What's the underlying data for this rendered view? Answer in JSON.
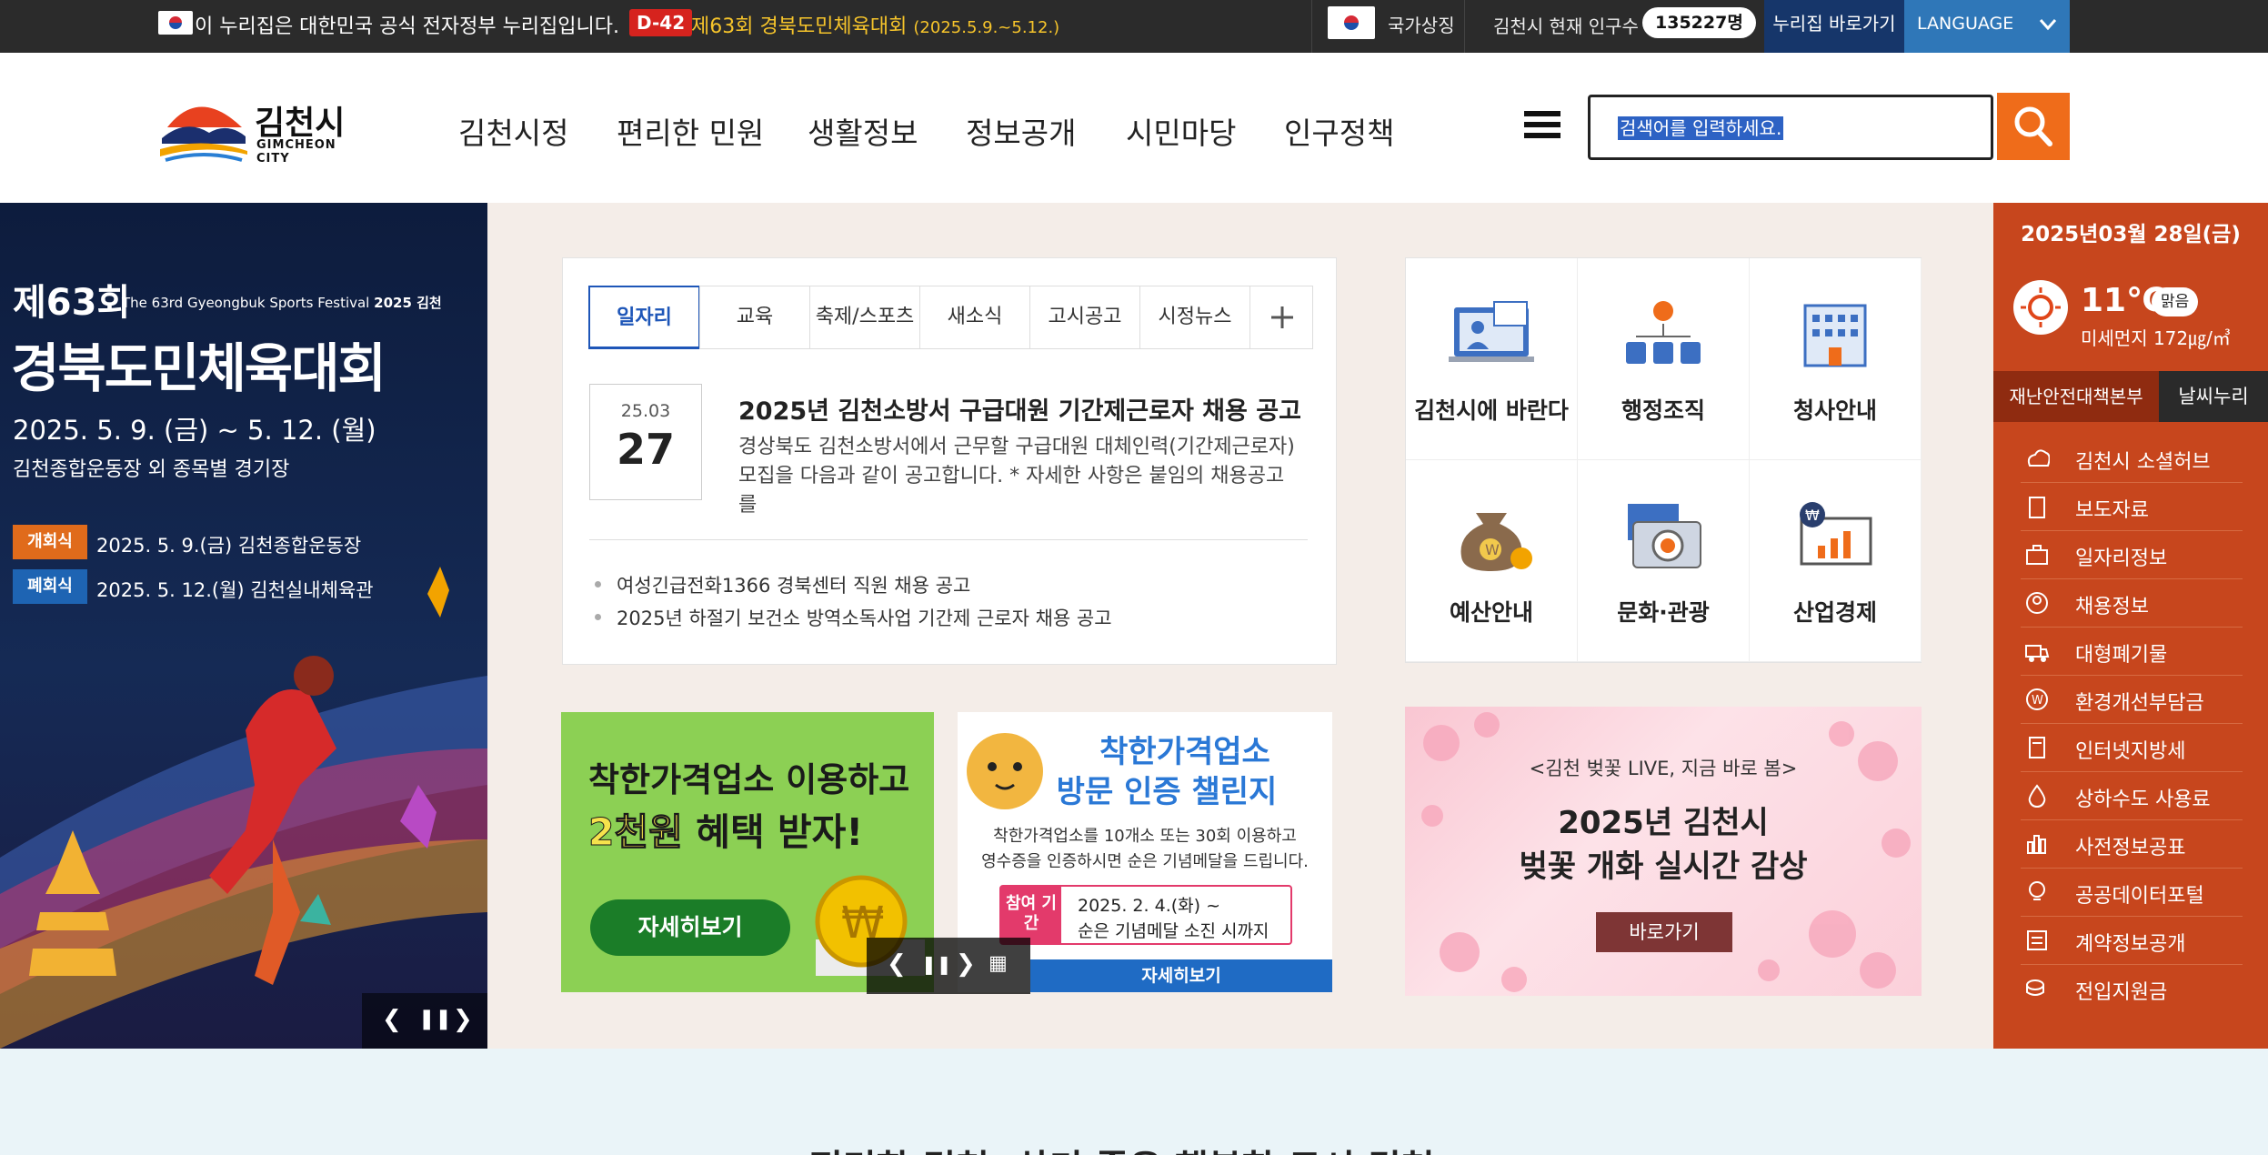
{
  "topbar": {
    "gov_notice": "이 누리집은 대한민국 공식 전자정부 누리집입니다.",
    "dday": "D-42",
    "event_title": "제63회 경북도민체육대회",
    "event_date": "(2025.5.9.~5.12.)",
    "national_symbol": "국가상징",
    "population_label": "김천시 현재 인구수",
    "population_value": "135227명",
    "shortcut": "누리집 바로가기",
    "language": "LANGUAGE"
  },
  "header": {
    "logo_ko": "김천시",
    "logo_en": "GIMCHEON CITY",
    "nav": [
      "김천시정",
      "편리한 민원",
      "생활정보",
      "정보공개",
      "시민마당",
      "인구정책"
    ],
    "search_placeholder": "검색어를 입력하세요."
  },
  "left_banner": {
    "edition": "제63회",
    "subtitle_en": "The 63rd Gyeongbuk Sports Festival",
    "year_mark": "2025 김천",
    "title": "경북도민체육대회",
    "date_range": "2025. 5. 9. (금) ~ 5. 12. (월)",
    "venue": "김천종합운동장 외 종목별 경기장",
    "open_tag": "개회식",
    "open_info": "2025. 5. 9.(금) 김천종합운동장",
    "close_tag": "폐회식",
    "close_info": "2025. 5. 12.(월) 김천실내체육관"
  },
  "news": {
    "tabs": [
      "일자리",
      "교육",
      "축제/스포츠",
      "새소식",
      "고시공고",
      "시정뉴스"
    ],
    "featured": {
      "date_ym": "25.03",
      "date_d": "27",
      "title": "2025년 김천소방서 구급대원 기간제근로자 채용 공고",
      "desc": "경상북도 김천소방서에서 근무할 구급대원 대체인력(기간제근로자) 모집을 다음과 같이 공고합니다. * 자세한 사항은 붙임의 채용공고를"
    },
    "list": [
      "여성긴급전화1366 경북센터 직원 채용 공고",
      "2025년 하절기 보건소 방역소독사업 기간제 근로자 채용 공고"
    ]
  },
  "quick_menu": [
    "김천시에 바란다",
    "행정조직",
    "청사안내",
    "예산안내",
    "문화·관광",
    "산업경제"
  ],
  "promo1": {
    "line1": "착한가격업소 이용하고",
    "line2_highlight": "2천원",
    "line2_rest": " 혜택 받자!",
    "button": "자세히보기"
  },
  "promo2": {
    "title1": "착한가격업소",
    "title2": "방문 인증 챌린지",
    "desc1": "착한가격업소를 10개소 또는 30회 이용하고",
    "desc2": "영수증을 인증하시면 순은 기념메달을 드립니다.",
    "period_label": "참여 기간",
    "period_date": "2025. 2. 4.(화) ~",
    "period_note": "순은 기념메달 소진 시까지",
    "button": "자세히보기"
  },
  "cherry": {
    "small": "<김천 벚꽃 LIVE, 지금 바로 봄>",
    "title1": "2025년 김천시",
    "title2": "벚꽃 개화 실시간 감상",
    "button": "바로가기"
  },
  "right_panel": {
    "date": "2025년03월 28일(금)",
    "temp": "11℃",
    "condition": "맑음",
    "dust": "미세먼지 172㎍/㎥",
    "tab1": "재난안전대책본부",
    "tab2": "날씨누리",
    "links": [
      "김천시 소셜허브",
      "보도자료",
      "일자리정보",
      "채용정보",
      "대형폐기물",
      "환경개선부담금",
      "인터넷지방세",
      "상하수도 사용료",
      "사전정보공표",
      "공공데이터포털",
      "계약정보공개",
      "전입지원금"
    ]
  },
  "bottom": {
    "partial_text": "편리한 김천, 살기 좋은 행복한 도시 김천"
  },
  "colors": {
    "accent_orange": "#ef6c1a",
    "panel_orange": "#c7461d",
    "nav_blue": "#1e56b8",
    "topbar_dark": "#2b2b2b"
  }
}
